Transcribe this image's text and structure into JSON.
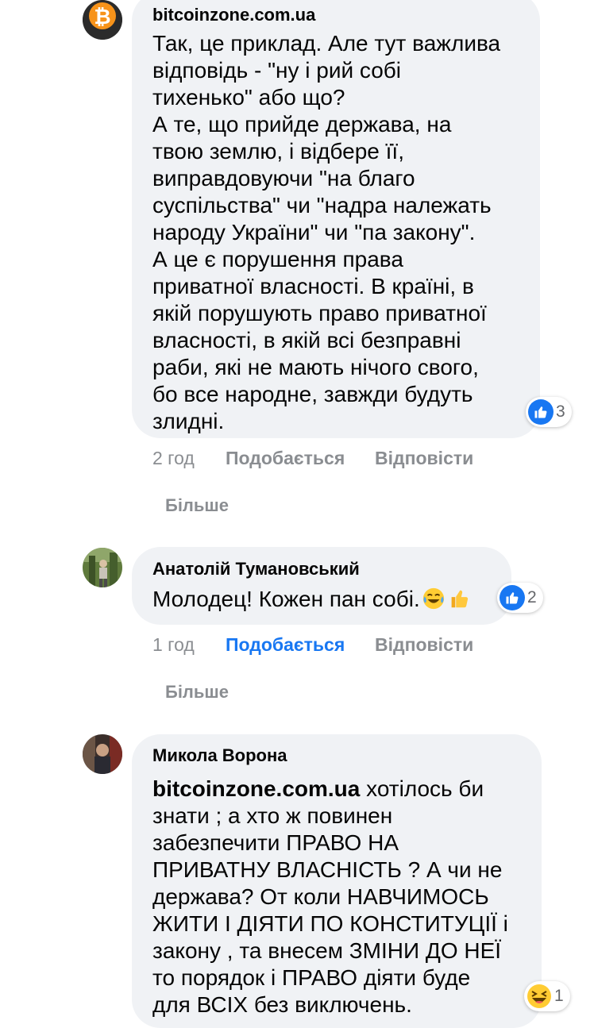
{
  "comments": [
    {
      "author": "bitcoinzone.com.ua",
      "lines": [
        "Так, це приклад. Але тут важлива",
        "відповідь - \"ну і рий собі",
        "тихенько\" або що?",
        "А те, що прийде держава, на",
        "твою землю, і відбере її,",
        "виправдовуючи \"на благо",
        "суспільства\" чи \"надра належать",
        "народу України\" чи \"па закону\".",
        "А це є порушення права",
        "приватної власності. В країні, в",
        "якій порушують право приватної",
        "власності, в якій всі безправні",
        "раби, які не мають нічого свого,",
        "бо все народне, завжди будуть",
        "злидні."
      ],
      "reaction_count": "3",
      "time": "2 год",
      "like_label": "Подобається",
      "reply_label": "Відповісти",
      "more_label": "Більше"
    },
    {
      "author": "Анатолій Тумановський",
      "text": "Молодец! Кожен пан собі.",
      "emojis": [
        "face-with-tears-of-joy-emoji",
        "thumbs-up-emoji"
      ],
      "reaction_count": "2",
      "time": "1 год",
      "like_label": "Подобається",
      "like_active": true,
      "reply_label": "Відповісти",
      "more_label": "Більше"
    },
    {
      "author": "Микола Ворона",
      "mention": "bitcoinzone.com.ua",
      "lines": [
        " хотілось би",
        "знати ; а хто ж повинен",
        "забезпечити ПРАВО НА",
        "ПРИВАТНУ ВЛАСНІСТЬ ? А чи не",
        "держава? От коли НАВЧИМОСЬ",
        "ЖИТИ І ДІЯТИ ПО КОНСТИТУЦІЇ і",
        "закону , та внесем ЗМІНИ ДО НЕЇ",
        "то порядок і ПРАВО діяти буде",
        "для ВСІХ без виключень."
      ],
      "reaction_count": "1"
    }
  ],
  "colors": {
    "bubble": "#f0f2f5",
    "meta": "#8a8d91",
    "like_active": "#1877f2",
    "bitcoin": "#f7931a"
  }
}
